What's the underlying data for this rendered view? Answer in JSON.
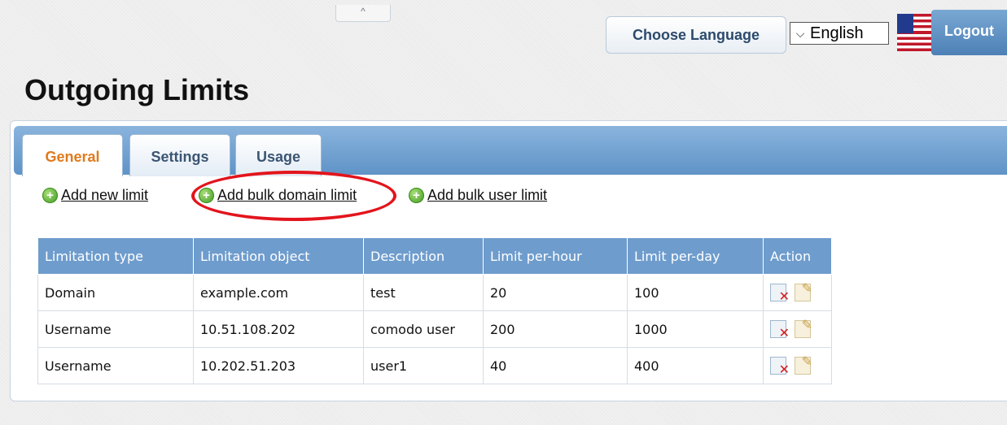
{
  "header": {
    "collapse_glyph": "^",
    "choose_language_label": "Choose Language",
    "language": {
      "selected": "English",
      "chevron": "⌵"
    },
    "flag_icon": "us-flag-icon",
    "logout_label": "Logout"
  },
  "page": {
    "title": "Outgoing Limits"
  },
  "tabs": [
    {
      "label": "General",
      "active": true
    },
    {
      "label": "Settings",
      "active": false
    },
    {
      "label": "Usage",
      "active": false
    }
  ],
  "actions": [
    {
      "label": "Add new limit",
      "icon": "plus-circle-icon"
    },
    {
      "label": "Add bulk domain limit",
      "icon": "plus-circle-icon",
      "highlighted": true
    },
    {
      "label": "Add bulk user limit",
      "icon": "plus-circle-icon"
    }
  ],
  "table": {
    "headers": [
      "Limitation type",
      "Limitation object",
      "Description",
      "Limit per-hour",
      "Limit per-day",
      "Action"
    ],
    "rows": [
      [
        "Domain",
        "example.com",
        "test",
        "20",
        "100"
      ],
      [
        "Username",
        "10.51.108.202",
        "comodo user",
        "200",
        "1000"
      ],
      [
        "Username",
        "10.202.51.203",
        "user1",
        "40",
        "400"
      ]
    ]
  },
  "colors": {
    "accent_tab_active": "#e07a1c",
    "table_header_bg": "#6e9ccd",
    "highlight_ring": "#e3141c"
  }
}
